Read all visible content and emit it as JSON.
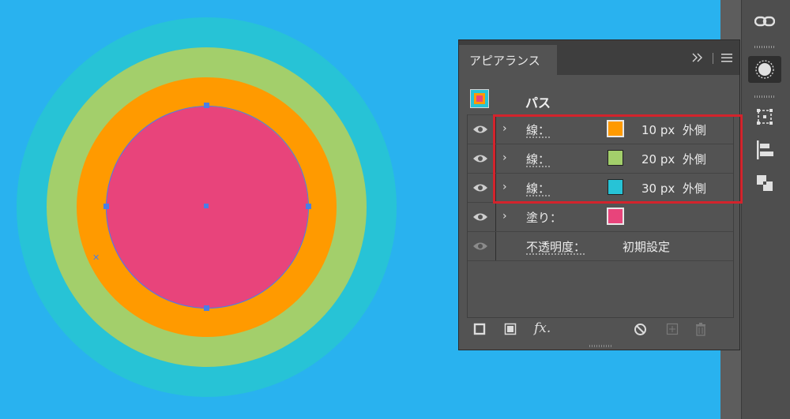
{
  "panel": {
    "tab_title": "アピアランス",
    "expand_icon": "double-chevron-right",
    "menu_icon": "hamburger-menu",
    "object_label": "パス",
    "rows": [
      {
        "type": "stroke",
        "label": "線：",
        "width": "10 px",
        "align": "外側",
        "color": "#ff9a00"
      },
      {
        "type": "stroke",
        "label": "線：",
        "width": "20 px",
        "align": "外側",
        "color": "#a3cf6b"
      },
      {
        "type": "stroke",
        "label": "線：",
        "width": "30 px",
        "align": "外側",
        "color": "#27c3d6"
      },
      {
        "type": "fill",
        "label": "塗り：",
        "color": "#e8447b"
      },
      {
        "type": "opacity",
        "label": "不透明度：",
        "value": "初期設定"
      }
    ],
    "footer": {
      "fx_label": "fx.",
      "icons": [
        "add-new-stroke-icon",
        "add-new-fill-icon",
        "add-effect-icon",
        "clear-appearance-icon",
        "duplicate-item-icon",
        "delete-item-icon"
      ]
    }
  },
  "canvas": {
    "background": "#29b2ef",
    "ring_colors": {
      "outer": "#27c3d6",
      "middle": "#a3cf6b",
      "inner": "#ff9a00",
      "fill": "#e8447b"
    },
    "path_color": "#4a7ee6"
  },
  "toolbar": {
    "icons": [
      "link-icon",
      "appearance-icon",
      "transform-icon",
      "align-icon",
      "pathfinder-icon"
    ]
  },
  "highlight_color": "#d3232c"
}
